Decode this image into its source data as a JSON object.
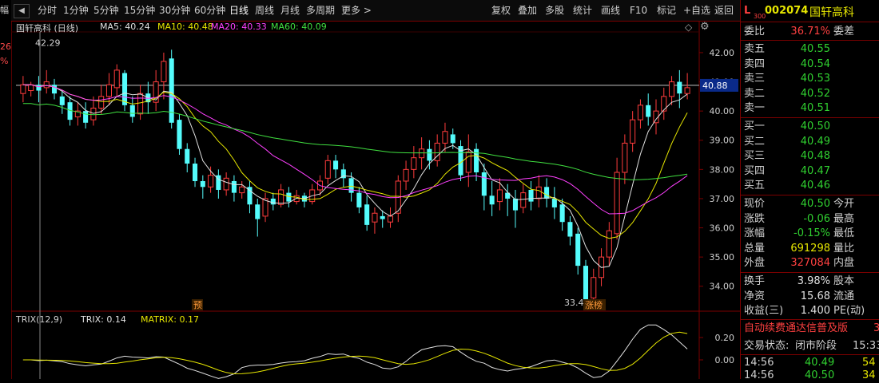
{
  "left_strip": {
    "labels": [
      "幅",
      "26",
      "%"
    ]
  },
  "toolbar": {
    "arrow_left": "◀",
    "arrow_right": "▶",
    "periods": [
      "分时",
      "1分钟",
      "5分钟",
      "15分钟",
      "30分钟",
      "60分钟",
      "日线",
      "周线",
      "月线",
      "多周期",
      "更多 >"
    ],
    "active_period": "日线",
    "right_buttons": [
      "复权",
      "叠加",
      "多股",
      "统计",
      "画线",
      "F10",
      "标记",
      "+自选",
      "返回"
    ]
  },
  "main_chart": {
    "title": "国轩高科 (日线)",
    "ma_labels": [
      {
        "text": "MA5: 40.24",
        "color": "#e0e0e0"
      },
      {
        "text": "MA10: 40.48",
        "color": "#e6e600"
      },
      {
        "text": "MA20: 40.33",
        "color": "#ff40ff"
      },
      {
        "text": "MA60: 40.09",
        "color": "#40e040"
      }
    ],
    "price_axis": [
      "42.00",
      "41.00",
      "40.00",
      "39.00",
      "38.00",
      "37.00",
      "36.00",
      "35.00",
      "34.00"
    ],
    "current_price_tag": "40.88",
    "high_annotation": "42.29",
    "low_annotation": "33.45",
    "marker_pre": "预",
    "marker_limit": "涨榜",
    "icons": [
      "diamond-icon",
      "gear-icon"
    ]
  },
  "trix": {
    "label": "TRIX(12,9)",
    "trix_value": "TRIX: 0.14",
    "matrix_value": "MATRIX: 0.17",
    "axis": [
      "0.20",
      "0.00"
    ]
  },
  "chart_data": {
    "type": "candlestick",
    "ylim": [
      33.2,
      42.6
    ],
    "candles": [
      [
        40.6,
        40.9,
        40.3,
        41.2
      ],
      [
        40.7,
        40.9,
        40.5,
        41.0
      ],
      [
        40.9,
        40.7,
        40.3,
        41.2
      ],
      [
        40.8,
        41.0,
        40.6,
        41.4
      ],
      [
        40.9,
        40.6,
        40.4,
        41.1
      ],
      [
        40.5,
        40.2,
        39.9,
        40.7
      ],
      [
        40.3,
        39.7,
        39.5,
        40.5
      ],
      [
        39.8,
        40.0,
        39.5,
        40.3
      ],
      [
        40.0,
        39.6,
        39.4,
        40.3
      ],
      [
        39.7,
        40.1,
        39.5,
        40.5
      ],
      [
        40.1,
        40.5,
        39.9,
        40.9
      ],
      [
        40.5,
        40.9,
        40.2,
        41.3
      ],
      [
        40.8,
        41.4,
        40.5,
        41.6
      ],
      [
        41.3,
        40.2,
        40.0,
        41.4
      ],
      [
        40.2,
        39.8,
        39.6,
        40.5
      ],
      [
        39.9,
        40.6,
        39.7,
        40.9
      ],
      [
        40.6,
        40.3,
        39.9,
        41.0
      ],
      [
        40.3,
        41.0,
        40.0,
        41.4
      ],
      [
        41.0,
        41.7,
        40.4,
        42.0
      ],
      [
        41.8,
        39.6,
        39.4,
        42.1
      ],
      [
        39.7,
        38.7,
        38.5,
        39.9
      ],
      [
        38.7,
        38.2,
        37.9,
        38.9
      ],
      [
        38.2,
        37.6,
        37.4,
        38.4
      ],
      [
        37.6,
        37.4,
        37.0,
        37.8
      ],
      [
        37.4,
        37.8,
        37.2,
        38.1
      ],
      [
        37.8,
        37.3,
        37.0,
        38.0
      ],
      [
        37.3,
        37.7,
        37.1,
        37.9
      ],
      [
        37.6,
        37.2,
        36.9,
        37.8
      ],
      [
        37.2,
        37.4,
        37.0,
        37.6
      ],
      [
        37.4,
        36.8,
        36.5,
        37.6
      ],
      [
        36.8,
        36.3,
        35.7,
        37.0
      ],
      [
        36.4,
        37.0,
        36.2,
        37.2
      ],
      [
        37.0,
        36.8,
        36.6,
        37.2
      ],
      [
        36.8,
        37.3,
        36.7,
        37.5
      ],
      [
        37.2,
        36.9,
        36.7,
        37.4
      ],
      [
        36.9,
        37.1,
        36.8,
        37.3
      ],
      [
        37.1,
        36.9,
        36.7,
        37.2
      ],
      [
        36.9,
        37.3,
        36.8,
        37.5
      ],
      [
        37.3,
        37.6,
        37.1,
        37.8
      ],
      [
        37.7,
        38.3,
        37.5,
        38.5
      ],
      [
        38.3,
        38.0,
        37.7,
        38.5
      ],
      [
        38.0,
        37.7,
        37.4,
        38.2
      ],
      [
        37.7,
        37.2,
        36.9,
        37.9
      ],
      [
        37.2,
        36.7,
        36.5,
        37.4
      ],
      [
        36.8,
        36.1,
        35.9,
        37.1
      ],
      [
        36.2,
        36.5,
        35.8,
        36.7
      ],
      [
        36.4,
        36.3,
        36.0,
        36.6
      ],
      [
        36.2,
        36.4,
        36.0,
        36.7
      ],
      [
        36.5,
        37.6,
        36.2,
        37.8
      ],
      [
        37.6,
        38.0,
        37.3,
        38.3
      ],
      [
        38.0,
        38.4,
        37.7,
        38.8
      ],
      [
        38.4,
        38.7,
        38.0,
        39.1
      ],
      [
        38.7,
        38.3,
        38.0,
        39.0
      ],
      [
        38.3,
        38.9,
        38.1,
        39.2
      ],
      [
        38.9,
        39.3,
        38.6,
        39.6
      ],
      [
        39.2,
        38.9,
        38.7,
        39.4
      ],
      [
        38.8,
        37.8,
        37.6,
        39.0
      ],
      [
        37.9,
        38.6,
        37.4,
        39.2
      ],
      [
        38.7,
        37.9,
        37.6,
        38.9
      ],
      [
        37.9,
        37.1,
        36.6,
        38.2
      ],
      [
        37.1,
        36.8,
        36.4,
        37.6
      ],
      [
        36.9,
        37.3,
        36.6,
        37.7
      ],
      [
        37.2,
        37.0,
        36.4,
        37.5
      ],
      [
        37.0,
        36.6,
        36.0,
        37.3
      ],
      [
        36.7,
        37.2,
        36.5,
        37.5
      ],
      [
        37.3,
        36.9,
        36.6,
        37.6
      ],
      [
        37.0,
        37.4,
        36.7,
        37.8
      ],
      [
        37.4,
        37.0,
        36.7,
        37.7
      ],
      [
        37.0,
        36.7,
        36.3,
        37.4
      ],
      [
        36.8,
        36.2,
        35.9,
        37.0
      ],
      [
        36.2,
        35.7,
        35.4,
        36.4
      ],
      [
        35.8,
        34.7,
        34.4,
        36.0
      ],
      [
        34.7,
        33.5,
        33.45,
        34.9
      ],
      [
        33.6,
        34.3,
        33.45,
        34.6
      ],
      [
        34.3,
        35.0,
        34.0,
        35.3
      ],
      [
        35.0,
        35.9,
        34.7,
        36.2
      ],
      [
        35.8,
        37.9,
        35.6,
        38.4
      ],
      [
        37.9,
        38.9,
        37.5,
        39.2
      ],
      [
        38.9,
        39.7,
        38.6,
        40.0
      ],
      [
        39.7,
        40.2,
        39.4,
        40.4
      ],
      [
        40.2,
        39.8,
        39.5,
        40.6
      ],
      [
        39.6,
        40.0,
        39.2,
        40.4
      ],
      [
        40.0,
        40.5,
        39.7,
        40.8
      ],
      [
        40.5,
        41.0,
        40.2,
        41.2
      ],
      [
        41.0,
        40.6,
        40.1,
        41.4
      ],
      [
        40.6,
        40.8,
        40.4,
        41.3
      ]
    ]
  },
  "quote": {
    "market_badge": "L",
    "badge_sub": "300",
    "code": "002074",
    "name": "国轩高科",
    "webi": {
      "label": "委比",
      "value": "36.71%",
      "label2": "委差"
    },
    "sells": [
      {
        "label": "卖五",
        "price": "40.55"
      },
      {
        "label": "卖四",
        "price": "40.54"
      },
      {
        "label": "卖三",
        "price": "40.53"
      },
      {
        "label": "卖二",
        "price": "40.52"
      },
      {
        "label": "卖一",
        "price": "40.51"
      }
    ],
    "buys": [
      {
        "label": "买一",
        "price": "40.50"
      },
      {
        "label": "买二",
        "price": "40.49"
      },
      {
        "label": "买三",
        "price": "40.48"
      },
      {
        "label": "买四",
        "price": "40.47"
      },
      {
        "label": "买五",
        "price": "40.46"
      }
    ],
    "stats": [
      {
        "label": "现价",
        "value": "40.50",
        "label2": "今开",
        "color": "#30d030"
      },
      {
        "label": "涨跌",
        "value": "-0.06",
        "label2": "最高",
        "color": "#30d030"
      },
      {
        "label": "涨幅",
        "value": "-0.15%",
        "label2": "最低",
        "color": "#30d030"
      },
      {
        "label": "总量",
        "value": "691298",
        "label2": "量比",
        "color": "#e6e600"
      },
      {
        "label": "外盘",
        "value": "327084",
        "label2": "内盘",
        "color": "#ff4040"
      }
    ],
    "stats2": [
      {
        "label": "换手",
        "value": "3.98%",
        "label2": "股本"
      },
      {
        "label": "净资",
        "value": "15.68",
        "label2": "流通"
      },
      {
        "label": "收益(三)",
        "value": "1.400",
        "label2": "PE(动)"
      }
    ],
    "ad_text": "自动续费通达信普及版",
    "ad_tail": "3",
    "status": {
      "label": "交易状态:",
      "value": "闭市阶段",
      "time": "15:33"
    },
    "ticks": [
      {
        "time": "14:56",
        "price": "40.49",
        "vol": "54"
      },
      {
        "time": "14:56",
        "price": "40.50",
        "vol": "34"
      }
    ]
  }
}
